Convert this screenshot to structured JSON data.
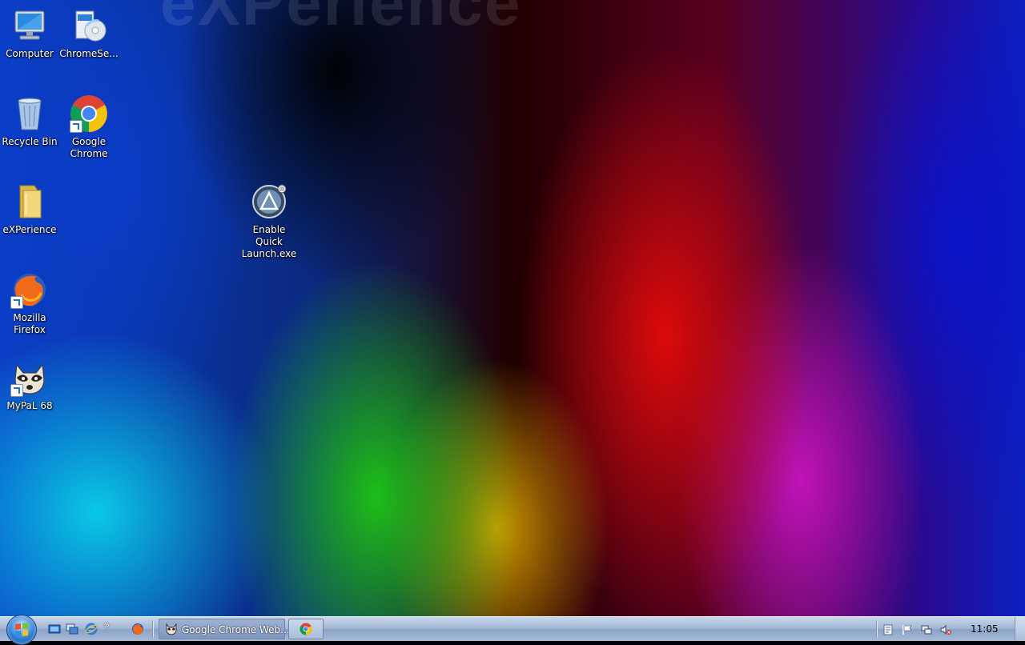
{
  "wallpaper": {
    "word": "eXPerience"
  },
  "desktop": {
    "icons": [
      {
        "label": "Computer",
        "icon": "computer-icon"
      },
      {
        "label": "ChromeSe...",
        "icon": "setup-disc-icon"
      },
      {
        "label": "Recycle Bin",
        "icon": "recycle-bin-icon"
      },
      {
        "label": "Google Chrome",
        "icon": "chrome-icon"
      },
      {
        "label": "eXPerience",
        "icon": "folder-icon"
      },
      {
        "label": "Enable Quick Launch.exe",
        "icon": "quick-launch-app-icon"
      },
      {
        "label": "Mozilla Firefox",
        "icon": "firefox-icon"
      },
      {
        "label": "MyPaL 68",
        "icon": "raccoon-browser-icon"
      }
    ]
  },
  "taskbar": {
    "start": {
      "icon": "windows-start-orb-icon"
    },
    "quick_launch": [
      {
        "icon": "show-desktop-icon"
      },
      {
        "icon": "switch-windows-icon"
      },
      {
        "icon": "internet-explorer-icon"
      },
      {
        "icon": "chevron-overflow-icon",
        "text": "»"
      },
      {
        "icon": "firefox-icon"
      }
    ],
    "tasks": [
      {
        "label": "Google Chrome Web...",
        "icon": "raccoon-browser-icon",
        "active": true
      },
      {
        "label": "",
        "icon": "chrome-icon",
        "active": false
      }
    ],
    "tray": [
      {
        "icon": "notes-icon"
      },
      {
        "icon": "action-center-flag-icon"
      },
      {
        "icon": "network-icon"
      },
      {
        "icon": "volume-muted-icon"
      }
    ],
    "clock": "11:05"
  },
  "colors": {
    "taskbar": "#a7bbd8",
    "label_text": "#ffffff",
    "clock_text": "#000000"
  }
}
